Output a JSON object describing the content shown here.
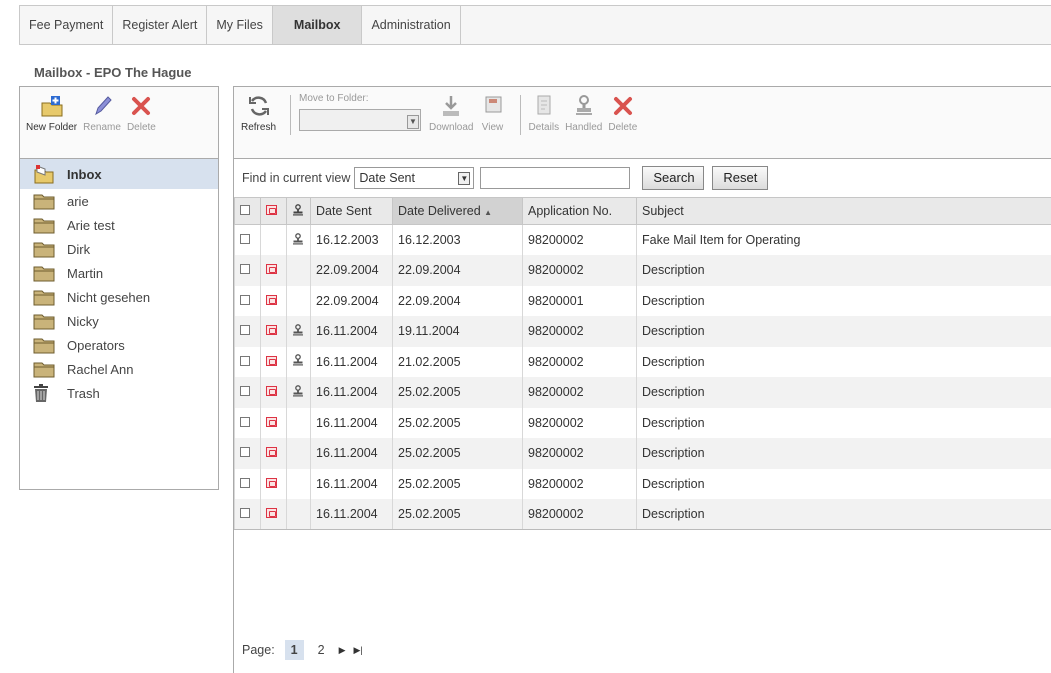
{
  "tabs": [
    {
      "label": "Fee Payment",
      "active": false
    },
    {
      "label": "Register Alert",
      "active": false
    },
    {
      "label": "My Files",
      "active": false
    },
    {
      "label": "Mailbox",
      "active": true
    },
    {
      "label": "Administration",
      "active": false
    }
  ],
  "title": "Mailbox - EPO The Hague",
  "folder_toolbar": {
    "new_folder": "New Folder",
    "rename": "Rename",
    "delete": "Delete"
  },
  "folders": [
    {
      "name": "Inbox",
      "icon": "inbox-icon",
      "selected": true
    },
    {
      "name": "arie",
      "icon": "folder-icon"
    },
    {
      "name": "Arie test",
      "icon": "folder-icon"
    },
    {
      "name": "Dirk",
      "icon": "folder-icon"
    },
    {
      "name": "Martin",
      "icon": "folder-icon"
    },
    {
      "name": "Nicht gesehen",
      "icon": "folder-icon"
    },
    {
      "name": "Nicky",
      "icon": "folder-icon"
    },
    {
      "name": "Operators",
      "icon": "folder-icon"
    },
    {
      "name": "Rachel Ann",
      "icon": "folder-icon"
    },
    {
      "name": "Trash",
      "icon": "trash-icon"
    }
  ],
  "main_toolbar": {
    "refresh": "Refresh",
    "move_to_folder": "Move to Folder:",
    "download": "Download",
    "view": "View",
    "details": "Details",
    "handled": "Handled",
    "delete": "Delete"
  },
  "find": {
    "label": "Find in current view",
    "field": "Date Sent",
    "search": "Search",
    "reset": "Reset"
  },
  "columns": [
    "Date Sent",
    "Date Delivered",
    "Application No.",
    "Subject"
  ],
  "rows": [
    {
      "registered": false,
      "handled": true,
      "date_sent": "16.12.2003",
      "date_delivered": "16.12.2003",
      "app_no": "98200002",
      "subject": "Fake Mail Item for Operating"
    },
    {
      "registered": true,
      "handled": false,
      "date_sent": "22.09.2004",
      "date_delivered": "22.09.2004",
      "app_no": "98200002",
      "subject": "Description"
    },
    {
      "registered": true,
      "handled": false,
      "date_sent": "22.09.2004",
      "date_delivered": "22.09.2004",
      "app_no": "98200001",
      "subject": "Description"
    },
    {
      "registered": true,
      "handled": true,
      "date_sent": "16.11.2004",
      "date_delivered": "19.11.2004",
      "app_no": "98200002",
      "subject": "Description"
    },
    {
      "registered": true,
      "handled": true,
      "date_sent": "16.11.2004",
      "date_delivered": "21.02.2005",
      "app_no": "98200002",
      "subject": "Description"
    },
    {
      "registered": true,
      "handled": true,
      "date_sent": "16.11.2004",
      "date_delivered": "25.02.2005",
      "app_no": "98200002",
      "subject": "Description"
    },
    {
      "registered": true,
      "handled": false,
      "date_sent": "16.11.2004",
      "date_delivered": "25.02.2005",
      "app_no": "98200002",
      "subject": "Description"
    },
    {
      "registered": true,
      "handled": false,
      "date_sent": "16.11.2004",
      "date_delivered": "25.02.2005",
      "app_no": "98200002",
      "subject": "Description"
    },
    {
      "registered": true,
      "handled": false,
      "date_sent": "16.11.2004",
      "date_delivered": "25.02.2005",
      "app_no": "98200002",
      "subject": "Description"
    },
    {
      "registered": true,
      "handled": false,
      "date_sent": "16.11.2004",
      "date_delivered": "25.02.2005",
      "app_no": "98200002",
      "subject": "Description"
    }
  ],
  "pager": {
    "label": "Page:",
    "pages": [
      "1",
      "2"
    ],
    "current": "1"
  }
}
